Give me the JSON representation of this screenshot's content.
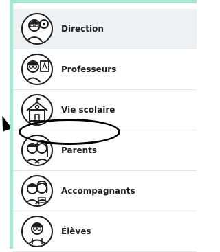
{
  "roles": [
    {
      "label": "Direction",
      "icon": "director-avatar-icon"
    },
    {
      "label": "Professeurs",
      "icon": "teacher-avatar-icon"
    },
    {
      "label": "Vie scolaire",
      "icon": "school-building-icon"
    },
    {
      "label": "Parents",
      "icon": "parents-avatar-icon"
    },
    {
      "label": "Accompagnants",
      "icon": "companions-avatar-icon"
    },
    {
      "label": "Élèves",
      "icon": "student-avatar-icon"
    }
  ],
  "colors": {
    "accent_border": "#a8e6cf",
    "active_row": "#eef1f4",
    "annotation": "#000000"
  }
}
